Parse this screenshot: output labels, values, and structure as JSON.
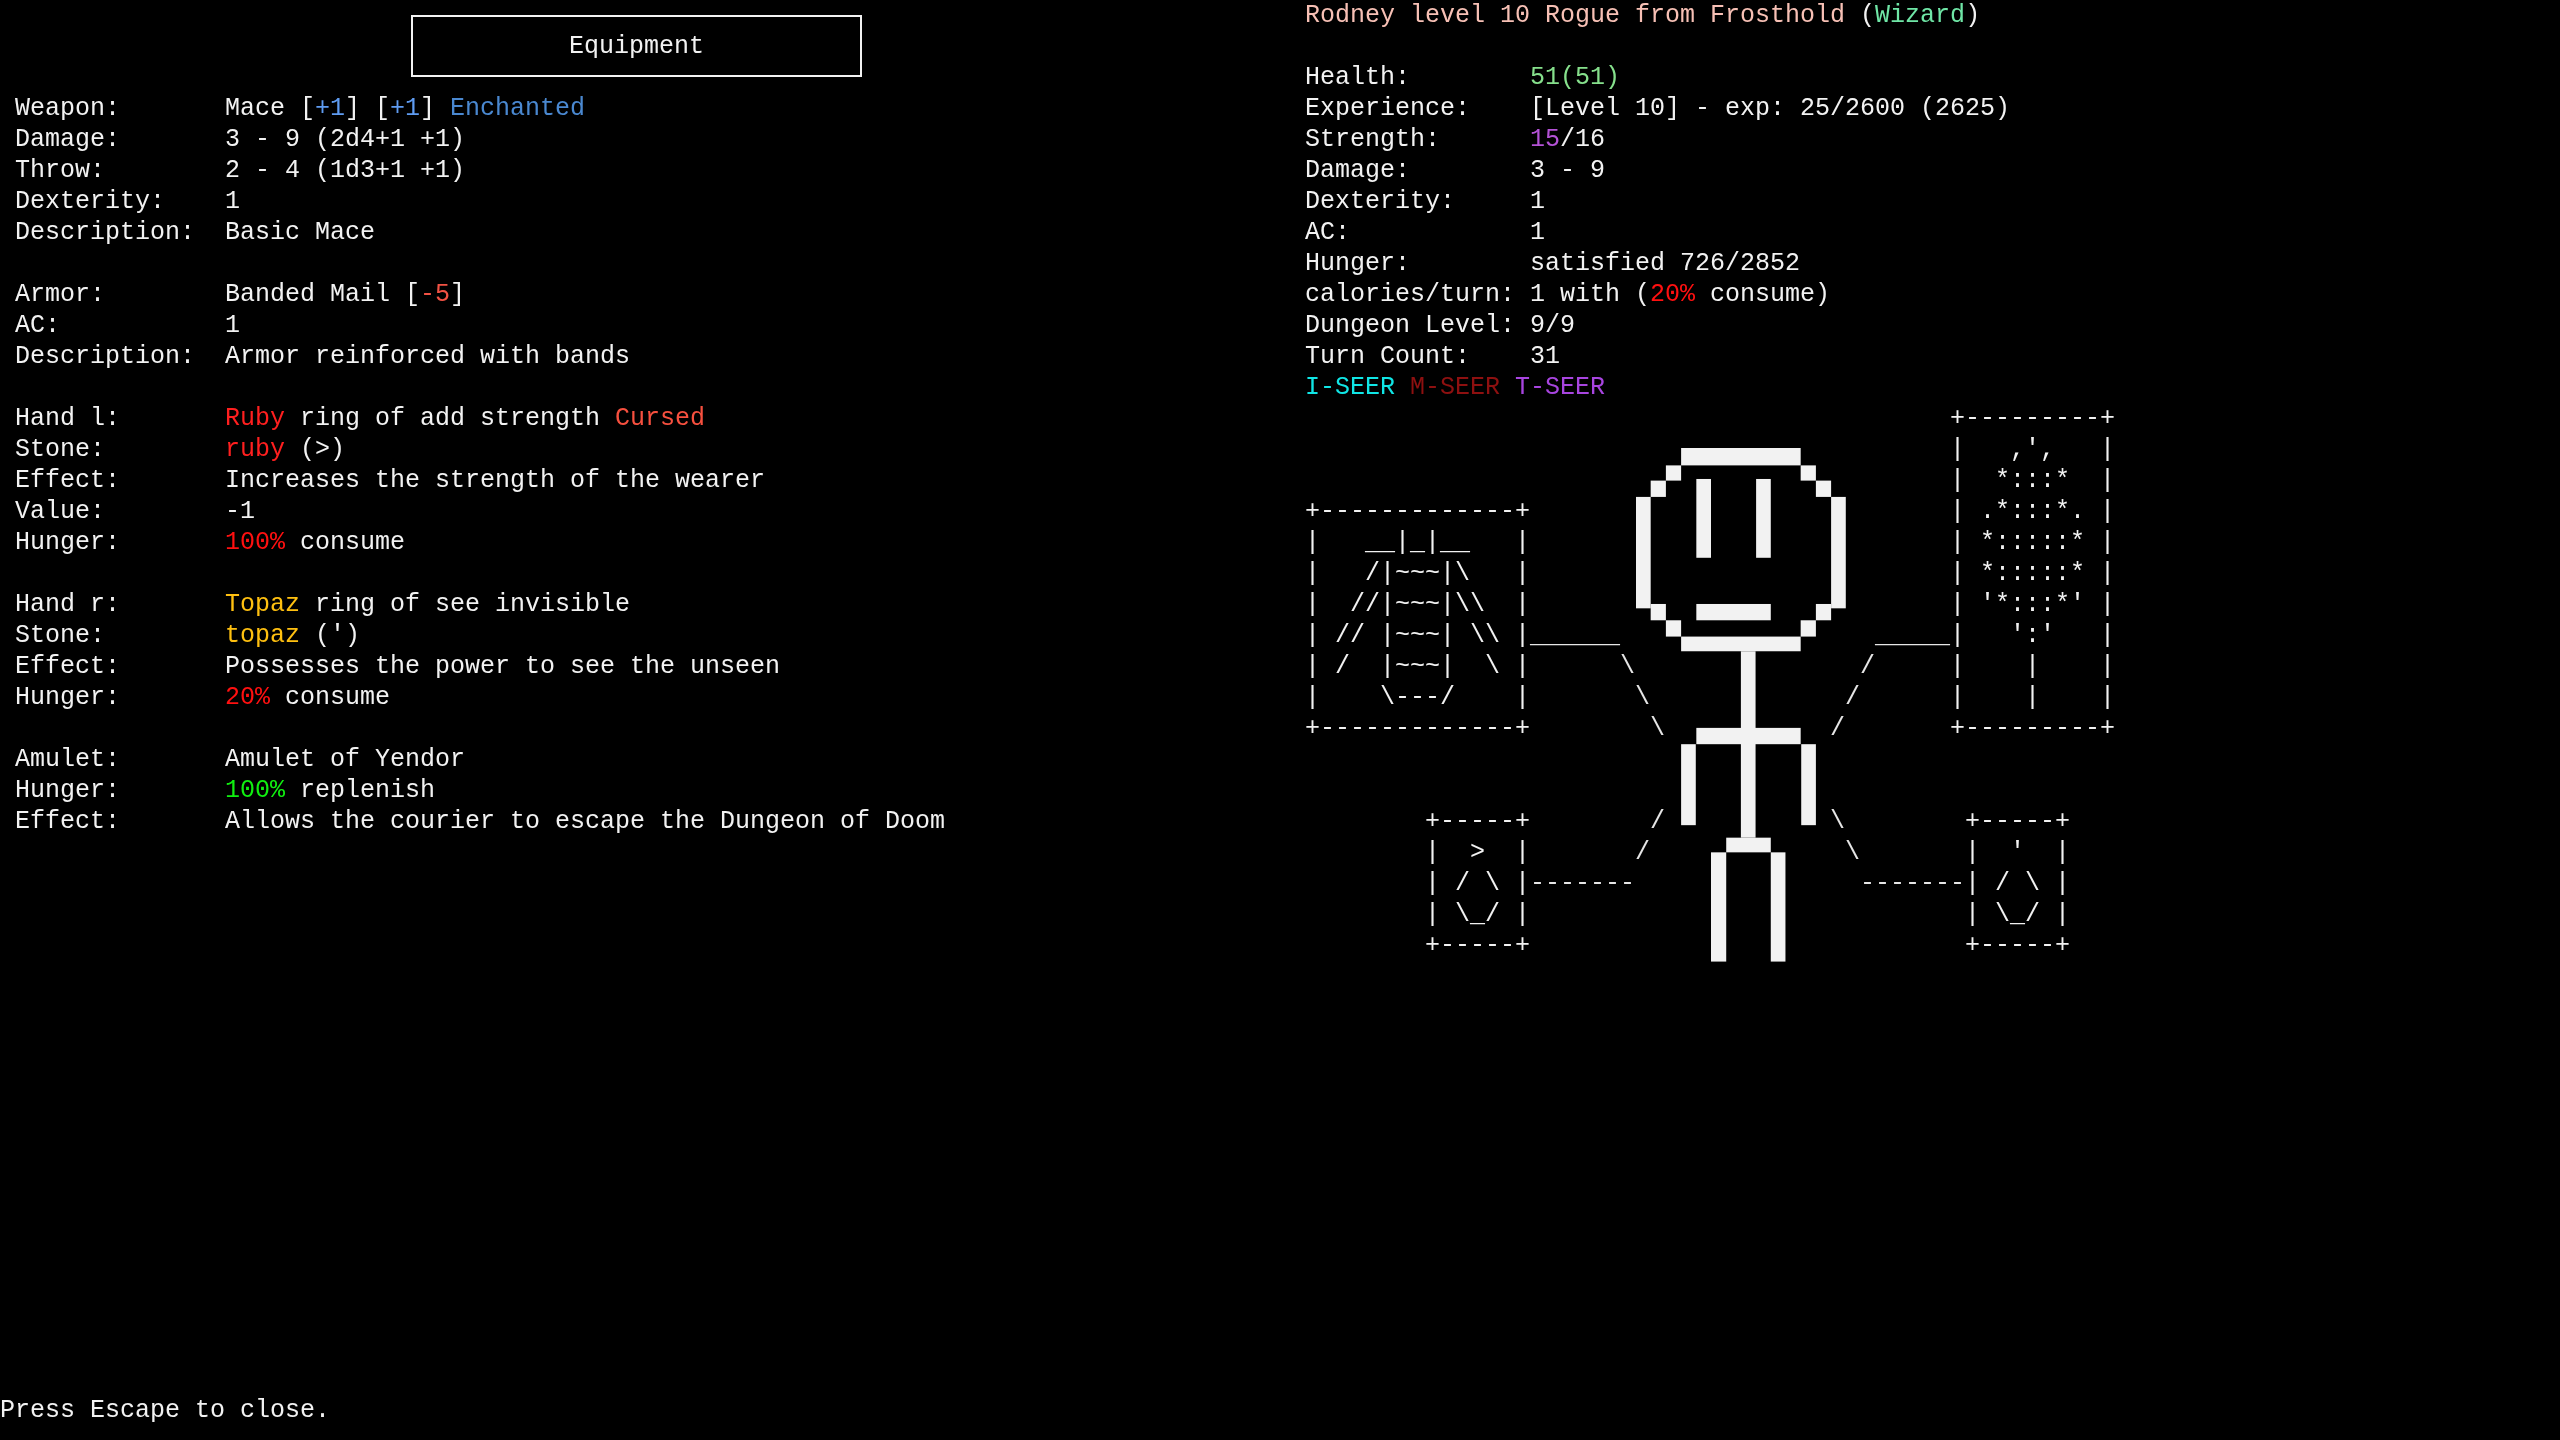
{
  "equipment": {
    "title": "Equipment",
    "sections": [
      {
        "rows": [
          {
            "label": "Weapon:",
            "value": [
              {
                "text": "Mace ["
              },
              {
                "text": "+1",
                "color": "#5f9cf2"
              },
              {
                "text": "] ["
              },
              {
                "text": "+1",
                "color": "#5f9cf2"
              },
              {
                "text": "] "
              },
              {
                "text": "Enchanted",
                "color": "#4a88d0"
              }
            ]
          },
          {
            "label": "Damage:",
            "value": [
              {
                "text": "3 - 9 (2d4+1 +1)"
              }
            ]
          },
          {
            "label": "Throw:",
            "value": [
              {
                "text": "2 - 4 (1d3+1 +1)"
              }
            ]
          },
          {
            "label": "Dexterity:",
            "value": [
              {
                "text": "1"
              }
            ]
          },
          {
            "label": "Description:",
            "value": [
              {
                "text": "Basic Mace"
              }
            ]
          }
        ]
      },
      {
        "rows": [
          {
            "label": "Armor:",
            "value": [
              {
                "text": "Banded Mail ["
              },
              {
                "text": "-5",
                "color": "#f25244"
              },
              {
                "text": "]"
              }
            ]
          },
          {
            "label": "AC:",
            "value": [
              {
                "text": "1"
              }
            ]
          },
          {
            "label": "Description:",
            "value": [
              {
                "text": "Armor reinforced with bands"
              }
            ]
          }
        ]
      },
      {
        "rows": [
          {
            "label": "Hand l:",
            "value": [
              {
                "text": "Ruby",
                "color": "#ff1f1f"
              },
              {
                "text": " ring of add strength "
              },
              {
                "text": "Cursed",
                "color": "#f7503f"
              }
            ]
          },
          {
            "label": "Stone:",
            "value": [
              {
                "text": "ruby",
                "color": "#ff1f1f"
              },
              {
                "text": " (>)"
              }
            ]
          },
          {
            "label": "Effect:",
            "value": [
              {
                "text": "Increases the strength of the wearer"
              }
            ]
          },
          {
            "label": "Value:",
            "value": [
              {
                "text": "-1"
              }
            ]
          },
          {
            "label": "Hunger:",
            "value": [
              {
                "text": "100%",
                "color": "#ff1010"
              },
              {
                "text": " consume"
              }
            ]
          }
        ]
      },
      {
        "rows": [
          {
            "label": "Hand r:",
            "value": [
              {
                "text": "Topaz",
                "color": "#ffc010"
              },
              {
                "text": " ring of see invisible"
              }
            ]
          },
          {
            "label": "Stone:",
            "value": [
              {
                "text": "topaz",
                "color": "#ffc010"
              },
              {
                "text": " (')"
              }
            ]
          },
          {
            "label": "Effect:",
            "value": [
              {
                "text": "Possesses the power to see the unseen"
              }
            ]
          },
          {
            "label": "Hunger:",
            "value": [
              {
                "text": "20%",
                "color": "#ff1010"
              },
              {
                "text": " consume"
              }
            ]
          }
        ]
      },
      {
        "rows": [
          {
            "label": "Amulet:",
            "value": [
              {
                "text": "Amulet of Yendor"
              }
            ]
          },
          {
            "label": "Hunger:",
            "value": [
              {
                "text": "100%",
                "color": "#10f010"
              },
              {
                "text": " replenish"
              }
            ]
          },
          {
            "label": "Effect:",
            "value": [
              {
                "text": "Allows the courier to escape the Dungeon of Doom"
              }
            ]
          }
        ]
      }
    ]
  },
  "character": {
    "title": [
      {
        "text": "Rodney level 10 Rogue from Frosthold ",
        "color": "#f7c0b5"
      },
      {
        "text": "("
      },
      {
        "text": "Wizard",
        "color": "#6fe6a6"
      },
      {
        "text": ")"
      }
    ],
    "stats": [
      {
        "label": "Health:",
        "value": [
          {
            "text": "51(51)",
            "color": "#86e08c"
          }
        ]
      },
      {
        "label": "Experience:",
        "value": [
          {
            "text": "[Level 10] - exp: 25/2600 (2625)"
          }
        ]
      },
      {
        "label": "Strength:",
        "value": [
          {
            "text": "15",
            "color": "#b452d6"
          },
          {
            "text": "/16"
          }
        ]
      },
      {
        "label": "Damage:",
        "value": [
          {
            "text": "3 - 9"
          }
        ]
      },
      {
        "label": "Dexterity:",
        "value": [
          {
            "text": "1"
          }
        ]
      },
      {
        "label": "AC:",
        "value": [
          {
            "text": "1"
          }
        ]
      },
      {
        "label": "Hunger:",
        "value": [
          {
            "text": "satisfied 726/2852"
          }
        ]
      },
      {
        "label": "calories/turn:",
        "value": [
          {
            "text": "1 with ("
          },
          {
            "text": "20%",
            "color": "#ff1010"
          },
          {
            "text": " consume)"
          }
        ]
      },
      {
        "label": "Dungeon Level:",
        "value": [
          {
            "text": "9/9"
          }
        ]
      },
      {
        "label": "Turn Count:",
        "value": [
          {
            "text": "31"
          }
        ]
      }
    ],
    "statuses": [
      {
        "label": "I-SEER",
        "color": "#10e6e6"
      },
      {
        "label": "M-SEER",
        "color": "#8e1010"
      },
      {
        "label": "T-SEER",
        "color": "#a845e0"
      }
    ],
    "paperdoll": [
      {
        "kind": "armor",
        "lines": [
          "+-------------+",
          "|   __|_|__   |",
          "|   /|~~~|\\   |",
          "|  //|~~~|\\\\  |",
          "| // |~~~| \\\\ |",
          "| /  |~~~|  \\ |",
          "|    \\---/    |",
          "+-------------+"
        ]
      },
      {
        "kind": "connector",
        "lines": [
          "______",
          "      \\",
          "       \\",
          "        \\"
        ]
      },
      {
        "kind": "connector",
        "lines": [
          "  /",
          " /",
          "/"
        ]
      },
      {
        "kind": "connector",
        "lines": [
          "_____"
        ]
      },
      {
        "kind": "amulet",
        "lines": [
          "+---------+",
          "|   ,',   |",
          "|  *:::*  |",
          "| .*:::*. |",
          "| *:::::* |",
          "| *:::::* |",
          "| '*:::*' |",
          "|   ':'   |",
          "|    |    |",
          "|    |    |",
          "+---------+"
        ]
      },
      {
        "kind": "ring",
        "lines": [
          "+-----+",
          "|  >  |",
          "| / \\ |",
          "| \\_/ |",
          "+-----+"
        ]
      },
      {
        "kind": "connector",
        "lines": [
          "        /",
          "       /",
          "-------"
        ]
      },
      {
        "kind": "connector",
        "lines": [
          "\\",
          " \\",
          "  -------"
        ]
      },
      {
        "kind": "ring",
        "lines": [
          "+-----+",
          "|  '  |",
          "| / \\ |",
          "| \\_/ |",
          "+-----+"
        ]
      }
    ]
  },
  "footer": "Press Escape to close."
}
